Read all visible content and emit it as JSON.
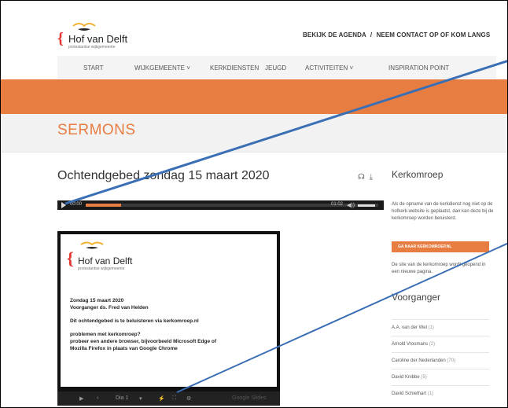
{
  "site": {
    "logo_name": "Hof van Delft",
    "logo_sub": "protestantse wijkgemeente",
    "brace_glyph": "{"
  },
  "toplinks": {
    "agenda": "BEKIJK DE AGENDA",
    "sep": "/",
    "contact": "NEEM CONTACT OP OF KOM LANGS"
  },
  "menu": {
    "items": [
      "START",
      "WIJKGEMEENTE ˅",
      "KERKDIENSTEN",
      "JEUGD",
      "ACTIVITEITEN ˅",
      "INSPIRATION POINT"
    ]
  },
  "page": {
    "title": "SERMONS"
  },
  "post": {
    "title": "Ochtendgebed zondag 15 maart 2020",
    "icons": [
      "headphones-icon",
      "download-icon"
    ],
    "headphones_glyph": "☊",
    "download_glyph": "⤓"
  },
  "audio": {
    "time_current": "00:00",
    "time_total": "01:02",
    "buffered_fraction": 0.12,
    "volume_glyph": "◀))"
  },
  "slide": {
    "logo_name": "Hof van Delft",
    "logo_sub": "protestantse wijkgemeente",
    "brace_glyph": "{",
    "lines": [
      "Zondag 15 maart 2020",
      "Voorganger ds. Fred van Helden",
      "Dit ochtendgebed is te beluisteren via kerkomroep.nl",
      "problemen met kerkomroep?",
      "probeer een andere browser, bijvoorbeeld Microsoft Edge of",
      "Mozilla Firefox in plaats van Google Chrome"
    ],
    "controls": {
      "play": "▶",
      "next": "›",
      "page": "Dia 1",
      "dropdown": "▾",
      "edit": "⚡",
      "fullscreen": "⛶",
      "settings": "⚙",
      "brand": "Google Slides"
    }
  },
  "sidebar": {
    "kerkomroep_heading": "Kerkomroep",
    "kerkomroep_text": "Als de opname van de kerkdienst nog niet op de hofkerk-website is geplaatst, dan kan deze bij de kerkomroep worden beluisterd.",
    "button_label": "GA NAAR KERKOMROEP.NL",
    "note": "De site van de kerkomroep wordt geopend in een nieuwe pagina.",
    "voorganger_heading": "Voorganger",
    "preachers": [
      {
        "name": "A.A. van der Wel",
        "count": "(1)"
      },
      {
        "name": "Arnold Vroomans",
        "count": "(2)"
      },
      {
        "name": "Caroline der Nederlanden",
        "count": "(70)"
      },
      {
        "name": "David Knibbe",
        "count": "(5)"
      },
      {
        "name": "David Schiethart",
        "count": "(1)"
      }
    ]
  },
  "colors": {
    "accent": "#e87d42",
    "annotation_line": "#3a6fb5"
  }
}
